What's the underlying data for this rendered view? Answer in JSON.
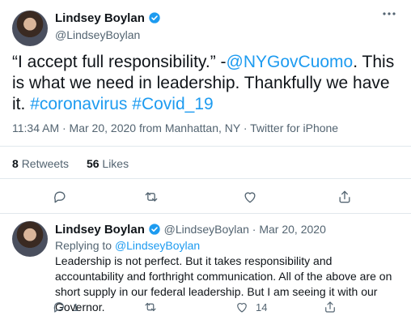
{
  "main_tweet": {
    "display_name": "Lindsey Boylan",
    "handle": "@LindseyBoylan",
    "text_part1": "“I accept full responsibility.” -",
    "mention": "@NYGovCuomo",
    "text_part2": ". This is what we need in leadership.  Thankfully we have it.",
    "hashtag1": "#coronavirus",
    "hashtag2": "#Covid_19",
    "meta": "11:34 AM · Mar 20, 2020 from Manhattan, NY · Twitter for iPhone",
    "retweets_count": "8",
    "retweets_label": "Retweets",
    "likes_count": "56",
    "likes_label": "Likes"
  },
  "reply_tweet": {
    "display_name": "Lindsey Boylan",
    "handle_date": "@LindseyBoylan · Mar 20, 2020",
    "replying_prefix": "Replying to",
    "replying_handle": "@LindseyBoylan",
    "text": "Leadership is not perfect. But it takes responsibility and accountability and forthright communication.  All of the above are on short supply in our federal leadership. But I am seeing it with our Governor.",
    "reply_count": "1",
    "like_count": "14"
  },
  "colors": {
    "accent": "#1d9bf0",
    "muted": "#536471",
    "text": "#0f1419"
  },
  "icons": [
    "verified-badge-icon",
    "more-options-icon",
    "reply-icon",
    "retweet-icon",
    "like-icon",
    "share-icon"
  ]
}
